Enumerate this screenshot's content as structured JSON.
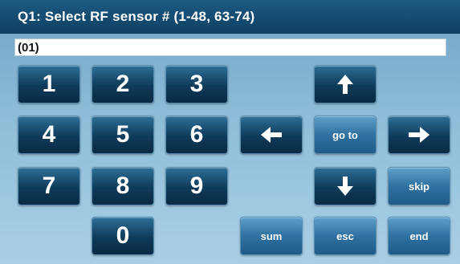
{
  "title": "Q1: Select RF sensor # (1-48, 63-74)",
  "input": {
    "value": "(01)"
  },
  "keypad": {
    "k1": "1",
    "k2": "2",
    "k3": "3",
    "k4": "4",
    "k5": "5",
    "k6": "6",
    "k7": "7",
    "k8": "8",
    "k9": "9",
    "k0": "0"
  },
  "controls": {
    "goto": "go to",
    "skip": "skip",
    "sum": "sum",
    "esc": "esc",
    "end": "end"
  },
  "icons": {
    "up": "arrow-up-icon",
    "down": "arrow-down-icon",
    "left": "arrow-left-icon",
    "right": "arrow-right-icon"
  }
}
